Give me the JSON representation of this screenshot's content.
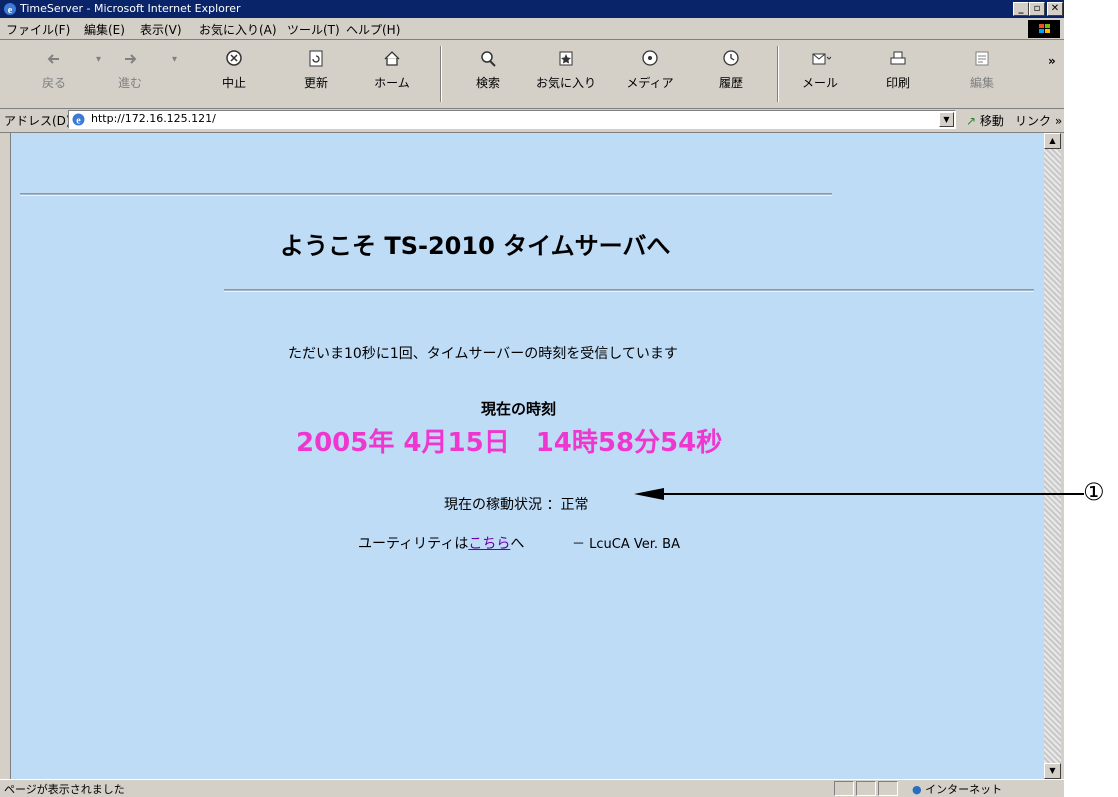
{
  "window": {
    "title": "TimeServer - Microsoft Internet Explorer",
    "minimize": "_",
    "maximize": "▫",
    "close": "✕"
  },
  "menu": [
    "ファイル(F)",
    "編集(E)",
    "表示(V)",
    "お気に入り(A)",
    "ツール(T)",
    "ヘルプ(H)"
  ],
  "toolbar": {
    "back": "戻る",
    "forward": "進む",
    "stop": "中止",
    "refresh": "更新",
    "home": "ホーム",
    "search": "検索",
    "favorites": "お気に入り",
    "media": "メディア",
    "history": "履歴",
    "mail": "メール",
    "print": "印刷",
    "edit": "編集",
    "more": "»"
  },
  "address": {
    "label": "アドレス(D)",
    "url": "http://172.16.125.121/",
    "go": "移動",
    "links": "リンク »"
  },
  "page": {
    "heading": "ようこそ TS-2010 タイムサーバへ",
    "message": "ただいま10秒に1回、タイムサーバーの時刻を受信しています",
    "time_label": "現在の時刻",
    "time_value": "2005年 4月15日　14時58分54秒",
    "status_label": "現在の稼動状況 ：",
    "status_value": "正常",
    "utility_prefix": "ユーティリティは",
    "utility_link": "こちら",
    "utility_suffix": "へ",
    "version": "－ LcuCA Ver. BA"
  },
  "annotation": {
    "callout": "①"
  },
  "statusbar": {
    "text": "ページが表示されました",
    "zone": "インターネット"
  },
  "colors": {
    "titlebar": "#0a246a",
    "page_background": "#bfdcf7",
    "time_color": "#ee37cf",
    "link_color": "#6b00a8"
  }
}
